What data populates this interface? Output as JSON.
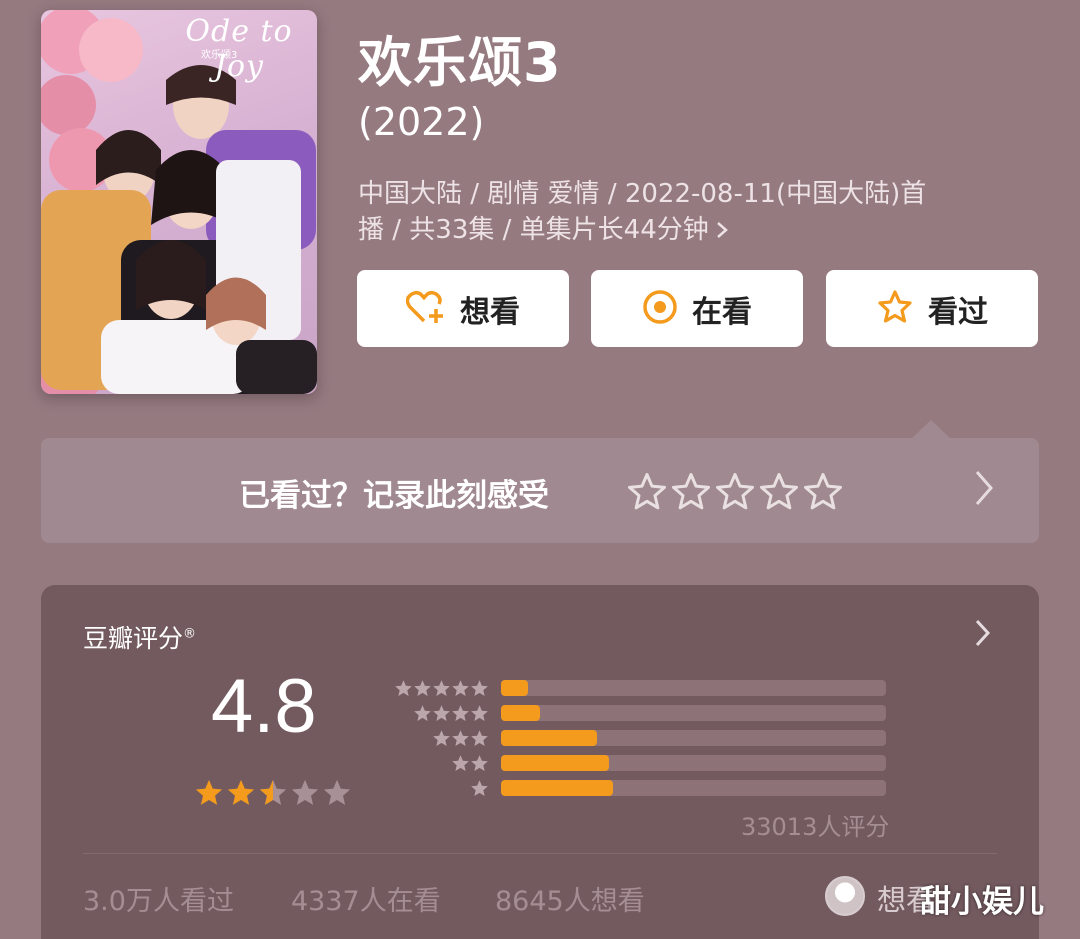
{
  "poster": {
    "title": "Ode to Joy",
    "subtitle": "欢乐颂3"
  },
  "header": {
    "title": "欢乐颂3",
    "year": "(2022)",
    "meta_line1": "中国大陆 / 剧情 爱情 / 2022-08-11(中国大陆)首",
    "meta_line2": "播 / 共33集 / 单集片长44分钟"
  },
  "actions": [
    {
      "label": "想看",
      "icon": "heart-plus-icon"
    },
    {
      "label": "在看",
      "icon": "target-icon"
    },
    {
      "label": "看过",
      "icon": "star-icon"
    }
  ],
  "rate_prompt": {
    "text": "已看过？记录此刻感受",
    "stars": 5
  },
  "rating": {
    "title": "豆瓣评分",
    "mark": "®",
    "score": "4.8",
    "stars_value": 2.5,
    "distribution": [
      {
        "stars": 5,
        "fraction": 0.07
      },
      {
        "stars": 4,
        "fraction": 0.1
      },
      {
        "stars": 3,
        "fraction": 0.25
      },
      {
        "stars": 2,
        "fraction": 0.28
      },
      {
        "stars": 1,
        "fraction": 0.29
      }
    ],
    "count_text": "33013人评分"
  },
  "stats": {
    "watched": "3.0万人看过",
    "watching": "4337人在看",
    "want": "8645人想看"
  },
  "footer_link": "想看",
  "watermark": "甜小娱儿",
  "colors": {
    "accent": "#f49a1c",
    "background": "#957a80",
    "card": "#735a5f"
  }
}
